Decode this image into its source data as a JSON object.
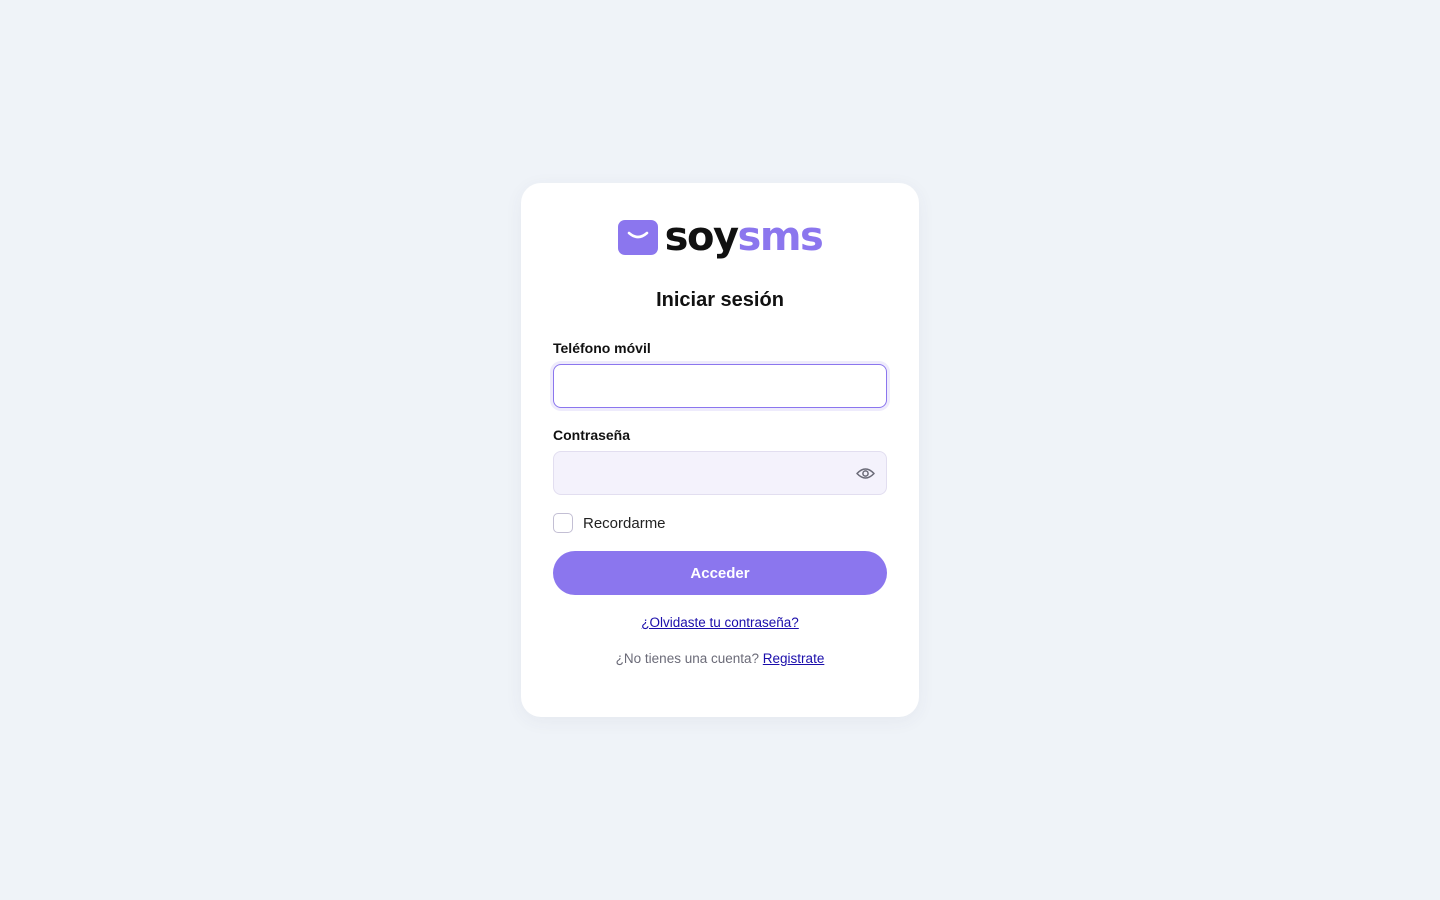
{
  "brand": {
    "name_dark": "soy",
    "name_accent": "sms",
    "logo_icon": "envelope-icon",
    "accent_color": "#8b76ee"
  },
  "form": {
    "title": "Iniciar sesión",
    "phone": {
      "label": "Teléfono móvil",
      "value": "",
      "placeholder": ""
    },
    "password": {
      "label": "Contraseña",
      "value": "",
      "placeholder": "",
      "toggle_icon": "eye-icon"
    },
    "remember": {
      "label": "Recordarme",
      "checked": false
    },
    "submit_label": "Acceder",
    "forgot_link": "¿Olvidaste tu contraseña?",
    "register_prompt": "¿No tienes una cuenta?",
    "register_link": "Registrate"
  },
  "colors": {
    "background": "#eff3f8",
    "card": "#ffffff",
    "link": "#1a0dab"
  }
}
